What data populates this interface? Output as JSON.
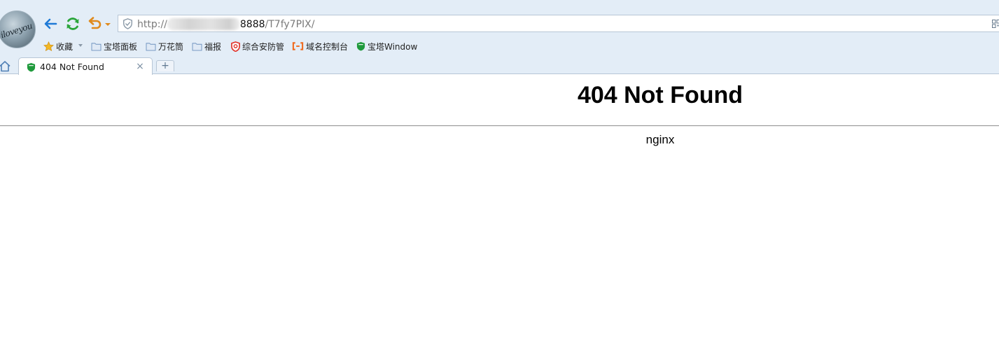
{
  "browser": {
    "address_bar": {
      "scheme": "http://",
      "host_suffix": "8888",
      "path": "/T7fy7PIX/"
    },
    "bookmarks": {
      "favorites_label": "收藏",
      "items": [
        {
          "label": "宝塔面板",
          "icon": "folder-icon"
        },
        {
          "label": "万花筒",
          "icon": "folder-icon"
        },
        {
          "label": "福报",
          "icon": "folder-icon"
        },
        {
          "label": "综合安防管",
          "icon": "security-shield-icon"
        },
        {
          "label": "域名控制台",
          "icon": "aliyun-bracket-icon"
        },
        {
          "label": "宝塔Window",
          "icon": "bt-shield-icon"
        }
      ]
    },
    "tabs": [
      {
        "title": "404 Not Found",
        "close_symbol": "×",
        "active": true
      }
    ],
    "new_tab_symbol": "+",
    "avatar_text": "iloveyou"
  },
  "page": {
    "heading": "404 Not Found",
    "server": "nginx"
  },
  "colors": {
    "chrome_bg": "#e3edf7",
    "back_arrow": "#1f7ad6",
    "refresh": "#2aa53a",
    "undo": "#e08a1c"
  }
}
